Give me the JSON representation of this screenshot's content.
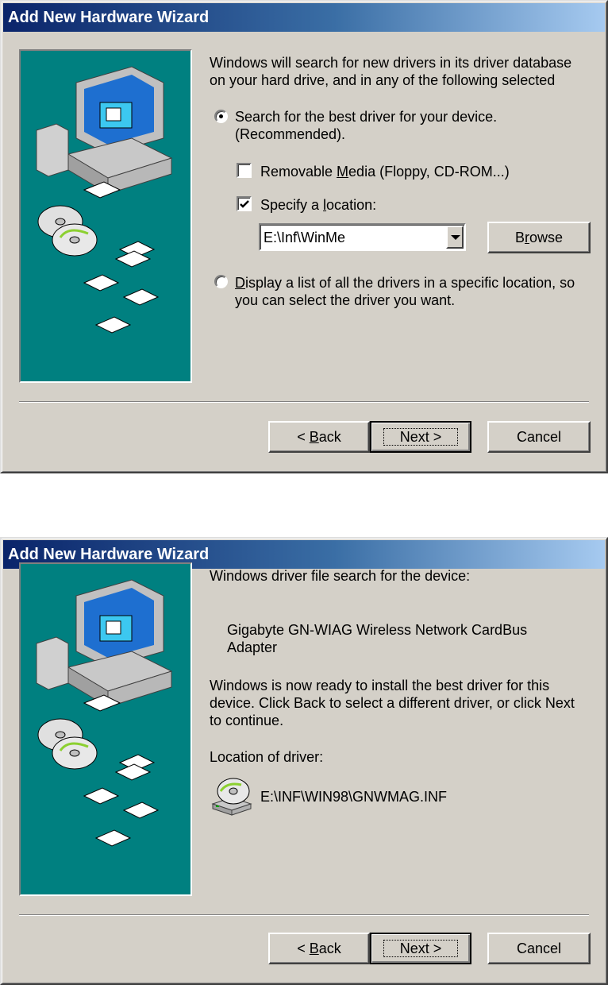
{
  "dialog1": {
    "title": "Add New Hardware Wizard",
    "intro_line1": "Windows will search for new drivers in its driver database",
    "intro_line2": "on your hard drive, and in any of the following selected",
    "option_search_line1": "Search for the best driver for your device.",
    "option_search_line2": "(Recommended).",
    "option_search_selected": true,
    "removable_pre": "Removable ",
    "removable_mnemonic": "M",
    "removable_post": "edia (Floppy, CD-ROM...)",
    "removable_checked": false,
    "specify_pre": "Specify a ",
    "specify_mnemonic": "l",
    "specify_post": "ocation:",
    "specify_checked": true,
    "location_value": "E:\\Inf\\WinMe",
    "browse_pre": "B",
    "browse_mnemonic": "r",
    "browse_post": "owse",
    "option_list_mnemonic": "D",
    "option_list_line1_post": "isplay a list of all the drivers in a specific location, so",
    "option_list_line2": "you can select the driver you want.",
    "back_pre": "< ",
    "back_mnemonic": "B",
    "back_post": "ack",
    "next_label": "Next >",
    "cancel_label": "Cancel"
  },
  "dialog2": {
    "title": "Add New Hardware Wizard",
    "heading": "Windows driver file search for the device:",
    "device_line1": "Gigabyte GN-WIAG Wireless Network CardBus",
    "device_line2": "Adapter",
    "ready_line1": "Windows is now ready to install the best driver for this",
    "ready_line2": "device. Click Back to select a different driver, or click Next",
    "ready_line3": "to continue.",
    "location_label": "Location of driver:",
    "driver_path": "E:\\INF\\WIN98\\GNWMAG.INF",
    "back_pre": "< ",
    "back_mnemonic": "B",
    "back_post": "ack",
    "next_label": "Next >",
    "cancel_label": "Cancel"
  },
  "colors": {
    "dialog_bg": "#d4d0c8",
    "art_bg": "#008080",
    "title_start": "#0a246a",
    "title_end": "#a6caf0"
  }
}
